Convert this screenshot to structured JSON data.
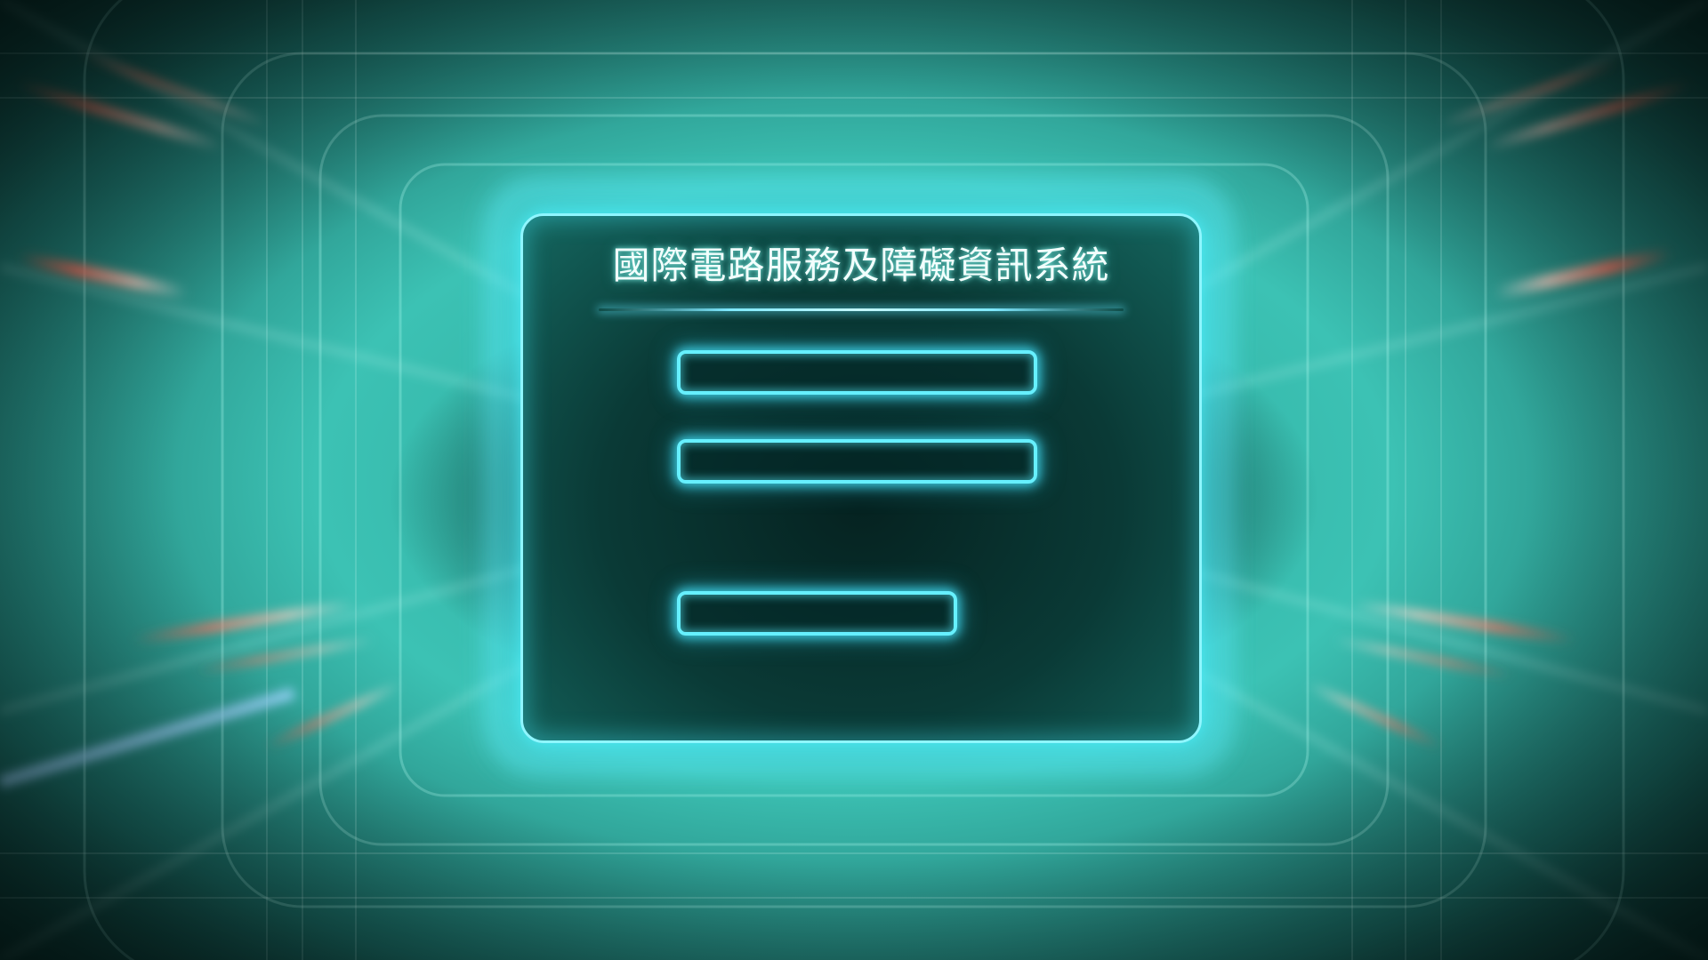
{
  "login": {
    "title": "國際電路服務及障礙資訊系統",
    "username": {
      "value": "",
      "placeholder": ""
    },
    "password": {
      "value": "",
      "placeholder": ""
    },
    "submit_label": ""
  },
  "theme": {
    "panel_glow": "#66f0ff",
    "background_teal": "#3cc2b4",
    "streak_red": "#ff6a5a"
  }
}
